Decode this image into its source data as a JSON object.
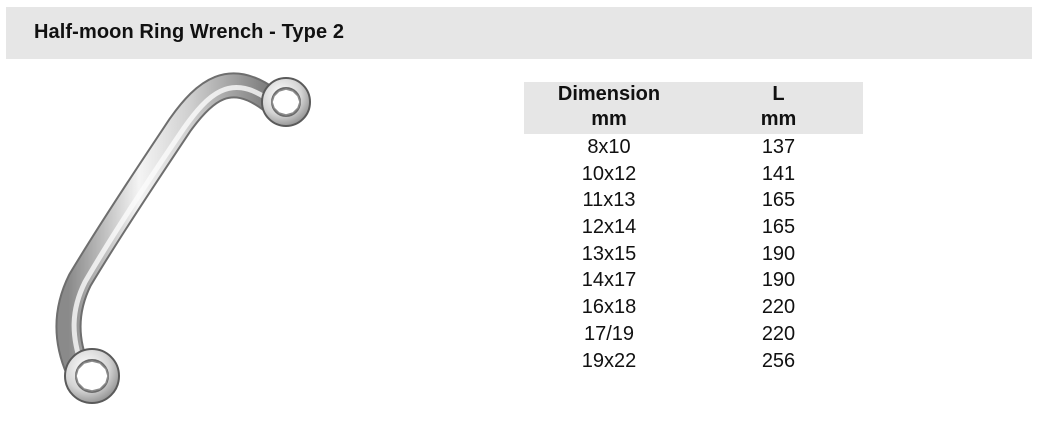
{
  "header": {
    "title": "Half-moon Ring Wrench - Type 2"
  },
  "product_image": {
    "icon": "half-moon-ring-wrench",
    "colors": {
      "metal_light": "#f2f2f2",
      "metal_mid": "#c8c8c8",
      "metal_dark": "#7a7a7a",
      "outline": "#5a5a5a"
    }
  },
  "spec_table": {
    "columns": [
      {
        "line1": "Dimension",
        "line2": "mm"
      },
      {
        "line1": "L",
        "line2": "mm"
      }
    ],
    "rows": [
      {
        "dimension": "8x10",
        "length": "137"
      },
      {
        "dimension": "10x12",
        "length": "141"
      },
      {
        "dimension": "11x13",
        "length": "165"
      },
      {
        "dimension": "12x14",
        "length": "165"
      },
      {
        "dimension": "13x15",
        "length": "190"
      },
      {
        "dimension": "14x17",
        "length": "190"
      },
      {
        "dimension": "16x18",
        "length": "220"
      },
      {
        "dimension": "17/19",
        "length": "220"
      },
      {
        "dimension": "19x22",
        "length": "256"
      }
    ],
    "header_bg": "#e6e6e6"
  }
}
